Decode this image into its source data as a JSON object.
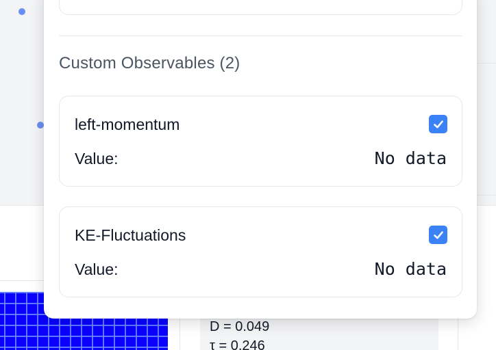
{
  "observables_section": {
    "title": "Custom Observables (2)",
    "items": [
      {
        "name": "left-momentum",
        "checked": true,
        "value_label": "Value:",
        "value": "No data"
      },
      {
        "name": "KE-Fluctuations",
        "checked": true,
        "value_label": "Value:",
        "value": "No data"
      }
    ]
  },
  "background": {
    "stats": {
      "diffusion": "D = 0.049",
      "tau": "τ = 0.246"
    },
    "grid_color": "#0a00ff",
    "dot_color": "#6b8ff0"
  },
  "colors": {
    "accent": "#3b82f6",
    "section_title": "#4b5563",
    "border": "#e5e7eb"
  },
  "icons": {
    "checkbox": "check-icon"
  }
}
